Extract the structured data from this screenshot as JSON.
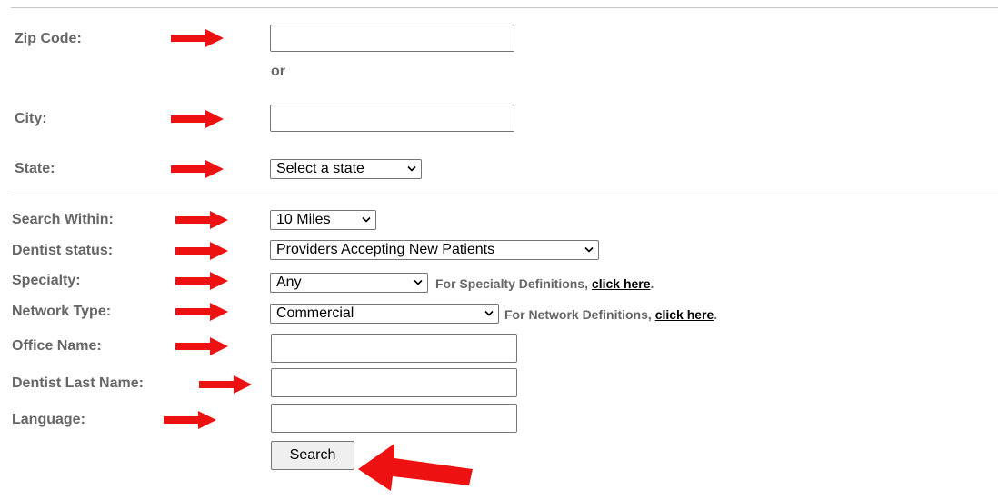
{
  "location": {
    "zip_label": "Zip Code:",
    "or_text": "or",
    "city_label": "City:",
    "state_label": "State:",
    "state_selected": "Select a state"
  },
  "filters": {
    "within_label": "Search Within:",
    "within_selected": "10 Miles",
    "status_label": "Dentist status:",
    "status_selected": "Providers Accepting New Patients",
    "specialty_label": "Specialty:",
    "specialty_selected": "Any",
    "specialty_note": "For Specialty Definitions, ",
    "specialty_link": "click here",
    "network_label": "Network Type:",
    "network_selected": "Commercial",
    "network_note": "For Network Definitions, ",
    "network_link": "click here",
    "office_label": "Office Name:",
    "lastname_label": "Dentist Last Name:",
    "language_label": "Language:"
  },
  "actions": {
    "search_label": "Search"
  },
  "colors": {
    "arrow": "#ee1111",
    "label": "#666666"
  },
  "icons": {
    "pointer": "red-arrow-icon",
    "dropdown": "chevron-down-icon"
  }
}
